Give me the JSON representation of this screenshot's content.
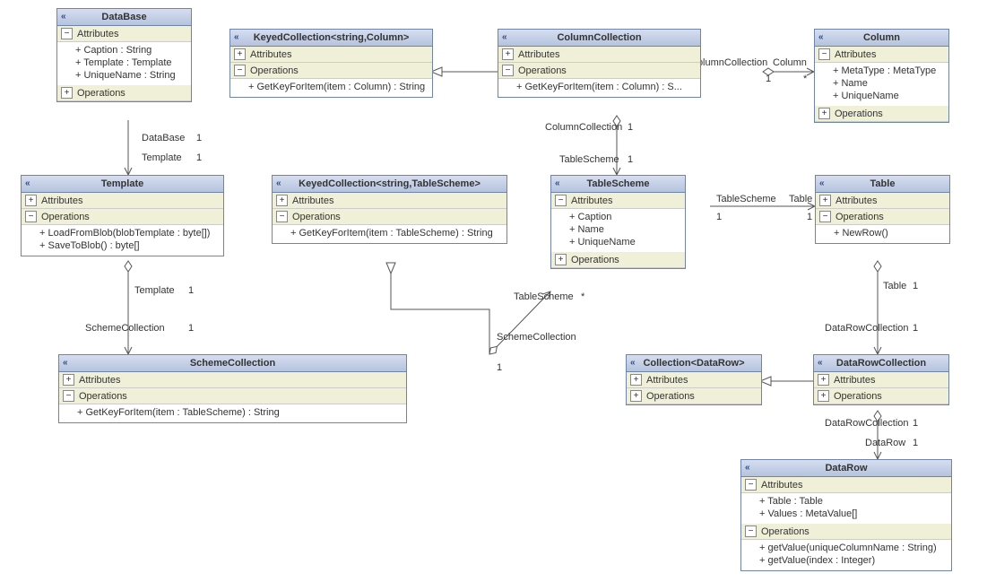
{
  "classes": {
    "database": {
      "title": "DataBase",
      "attributes": [
        "Caption : String",
        "Template : Template",
        "UniqueName : String"
      ],
      "operations": []
    },
    "keyedColumn": {
      "title": "KeyedCollection<string,Column>",
      "attributes": [],
      "operations": [
        "GetKeyForItem(item : Column) : String"
      ]
    },
    "columnCollection": {
      "title": "ColumnCollection",
      "attributes": [],
      "operations": [
        "GetKeyForItem(item : Column) : S..."
      ]
    },
    "column": {
      "title": "Column",
      "attributes": [
        "MetaType : MetaType",
        "Name",
        "UniqueName"
      ],
      "operations": []
    },
    "template": {
      "title": "Template",
      "attributes": [],
      "operations": [
        "LoadFromBlob(blobTemplate : byte[])",
        "SaveToBlob() : byte[]"
      ]
    },
    "keyedScheme": {
      "title": "KeyedCollection<string,TableScheme>",
      "attributes": [],
      "operations": [
        "GetKeyForItem(item : TableScheme) : String"
      ]
    },
    "tableScheme": {
      "title": "TableScheme",
      "attributes": [
        "Caption",
        "Name",
        "UniqueName"
      ],
      "operations": []
    },
    "table": {
      "title": "Table",
      "attributes": [],
      "operations": [
        "NewRow()"
      ]
    },
    "schemeCollection": {
      "title": "SchemeCollection",
      "attributes": [],
      "operations": [
        "GetKeyForItem(item : TableScheme) : String"
      ]
    },
    "collectionDataRow": {
      "title": "Collection<DataRow>",
      "attributes": [],
      "operations": []
    },
    "dataRowCollection": {
      "title": "DataRowCollection",
      "attributes": [],
      "operations": []
    },
    "dataRow": {
      "title": "DataRow",
      "attributes": [
        "Table : Table",
        "Values : MetaValue[]"
      ],
      "operations": [
        "getValue(uniqueColumnName : String)",
        "getValue(index : Integer)"
      ]
    }
  },
  "section_labels": {
    "attributes": "Attributes",
    "operations": "Operations"
  },
  "icon": {
    "chev": "«",
    "minus": "−",
    "plus": "+"
  },
  "assoc": {
    "database_template": {
      "a": "DataBase",
      "am": "1",
      "b": "Template",
      "bm": "1"
    },
    "template_scheme": {
      "a": "Template",
      "am": "1",
      "b": "SchemeCollection",
      "bm": "1"
    },
    "scheme_tablescheme": {
      "a": "SchemeCollection",
      "am": "1",
      "b": "TableScheme",
      "bm": "*"
    },
    "columncoll_tablescheme": {
      "a": "ColumnCollection",
      "am": "1",
      "b": "TableScheme",
      "bm": "1"
    },
    "columncoll_column": {
      "a": "ColumnCollection",
      "am": "1",
      "b": "Column",
      "bm": "*"
    },
    "tablescheme_table": {
      "a": "TableScheme",
      "am": "1",
      "b": "Table",
      "bm": "1"
    },
    "table_datarowcoll": {
      "a": "Table",
      "am": "1",
      "b": "DataRowCollection",
      "bm": "1"
    },
    "datarowcoll_datarow": {
      "a": "DataRowCollection",
      "am": "1",
      "b": "DataRow",
      "bm": "1"
    }
  }
}
